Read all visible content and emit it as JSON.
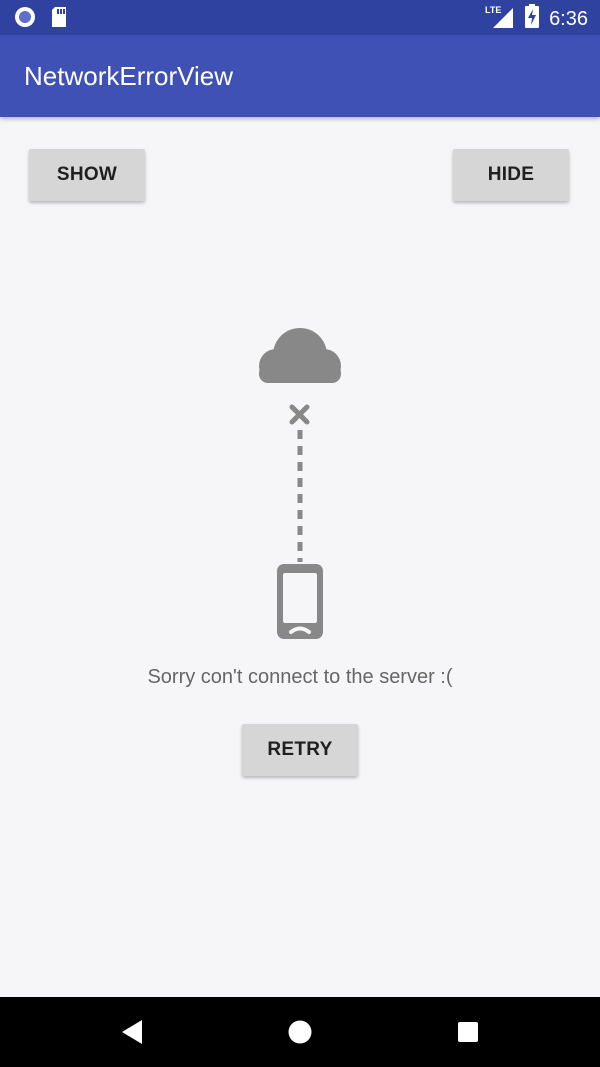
{
  "status_bar": {
    "time": "6:36",
    "network": "LTE",
    "icons": [
      "record-icon",
      "sd-card-icon",
      "lte-signal-icon",
      "battery-charging-icon"
    ]
  },
  "app_bar": {
    "title": "NetworkErrorView"
  },
  "buttons": {
    "show_label": "SHOW",
    "hide_label": "HIDE",
    "retry_label": "RETRY"
  },
  "error_view": {
    "message": "Sorry con't connect to the server :(",
    "icons": [
      "cloud-icon",
      "disconnect-x-icon",
      "dashed-line",
      "phone-icon"
    ]
  },
  "nav_bar": {
    "icons": [
      "back-icon",
      "home-icon",
      "recents-icon"
    ]
  },
  "colors": {
    "status_bar": "#2f42a0",
    "app_bar": "#3f51b5",
    "background": "#f6f5f7",
    "button": "#d6d6d6",
    "illustration": "#888888",
    "nav_bar": "#000000"
  }
}
